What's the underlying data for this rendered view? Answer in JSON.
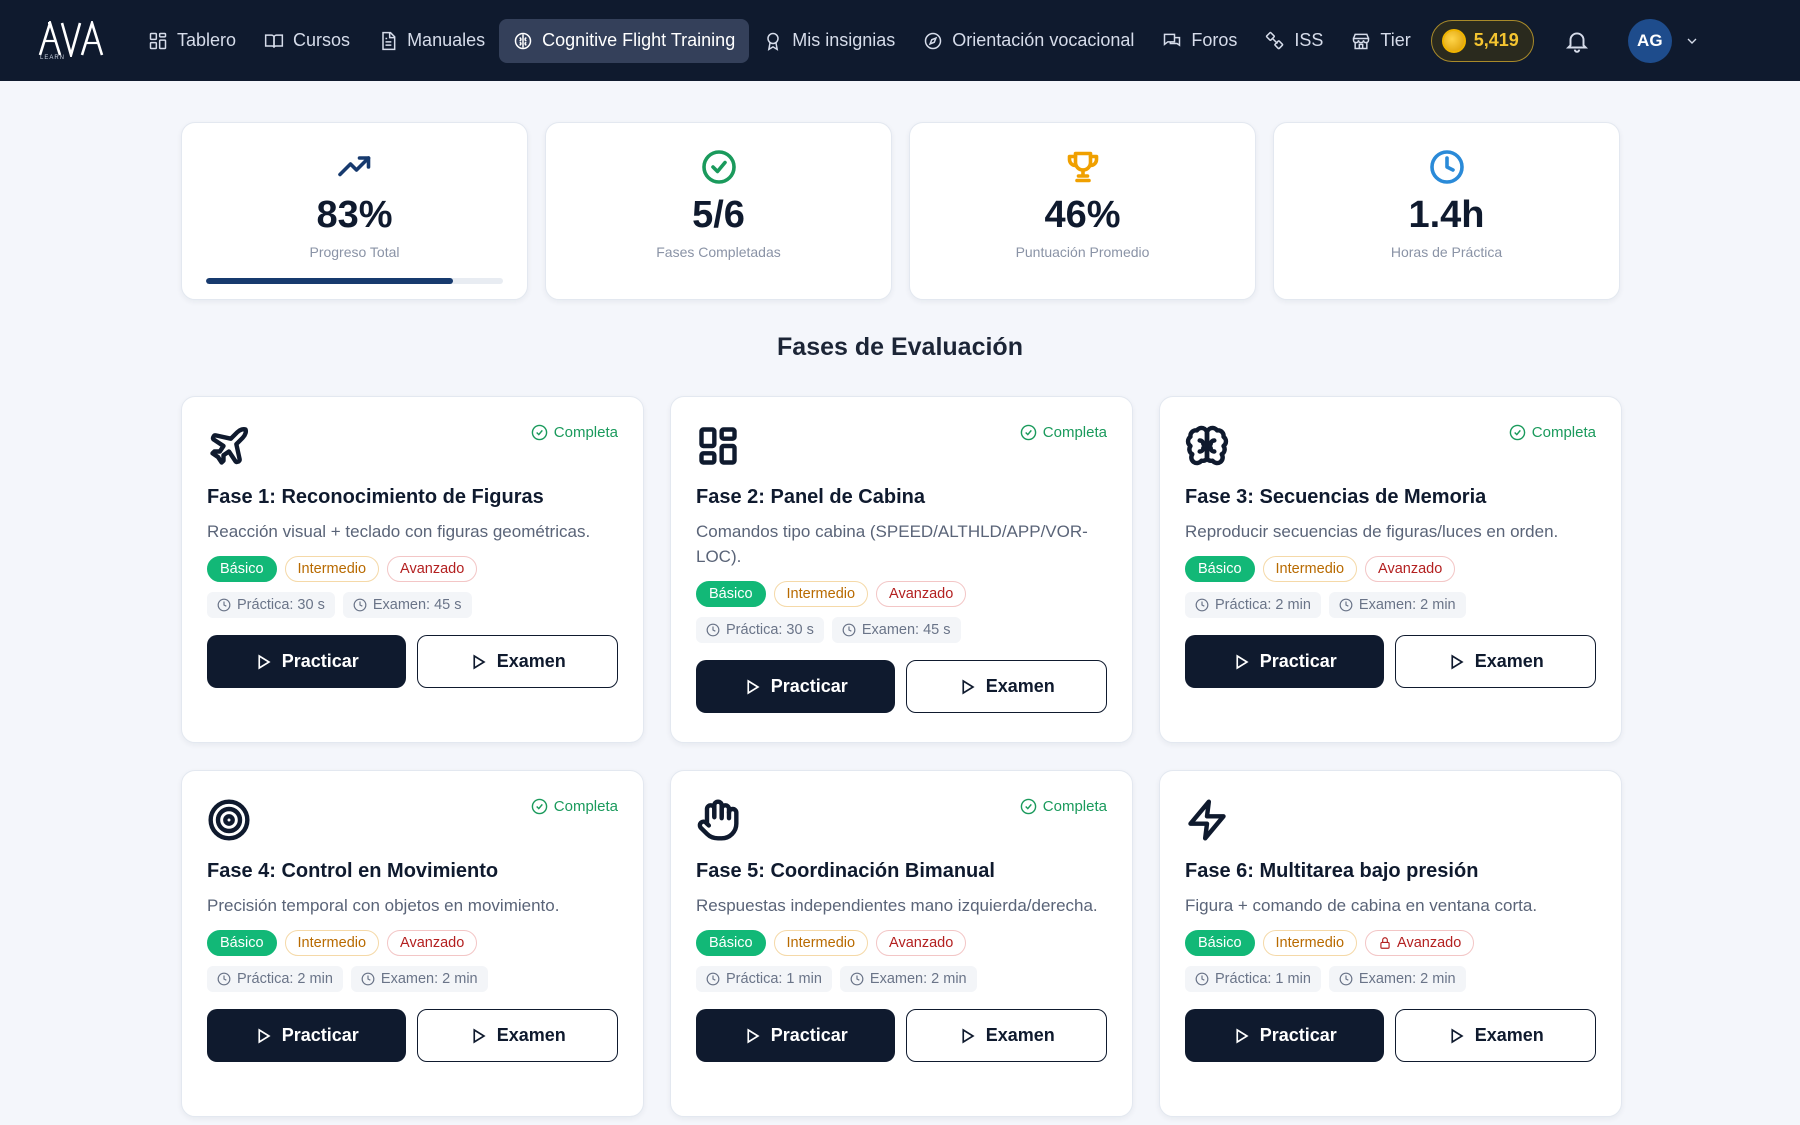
{
  "nav": {
    "logo_text": "AVIA",
    "logo_sub": "LEARN",
    "items": [
      {
        "label": "Tablero",
        "icon": "dashboard-icon"
      },
      {
        "label": "Cursos",
        "icon": "book-icon"
      },
      {
        "label": "Manuales",
        "icon": "document-icon"
      },
      {
        "label": "Cognitive Flight Training",
        "icon": "brain-icon",
        "active": true
      },
      {
        "label": "Mis insignias",
        "icon": "badge-icon"
      },
      {
        "label": "Orientación vocacional",
        "icon": "compass-icon"
      },
      {
        "label": "Foros",
        "icon": "chat-icon"
      },
      {
        "label": "ISS",
        "icon": "satellite-icon"
      },
      {
        "label": "Tier",
        "icon": "store-icon"
      }
    ],
    "coins": "5,419",
    "avatar_initials": "AG"
  },
  "stats": [
    {
      "value": "83%",
      "label": "Progreso Total",
      "icon": "trending-up-icon",
      "color": "#173a6e",
      "progress": 0.83
    },
    {
      "value": "5/6",
      "label": "Fases Completadas",
      "icon": "check-circle-icon",
      "color": "#1a9a5c"
    },
    {
      "value": "46%",
      "label": "Puntuación Promedio",
      "icon": "trophy-icon",
      "color": "#f0a000"
    },
    {
      "value": "1.4h",
      "label": "Horas de Práctica",
      "icon": "clock-icon",
      "color": "#2a8ad8"
    }
  ],
  "section_title": "Fases de Evaluación",
  "phases": [
    {
      "title": "Fase 1: Reconocimiento de Figuras",
      "desc": "Reacción visual + teclado con figuras geométricas.",
      "status": "Completa",
      "icon": "airplane-icon",
      "levels": [
        "Básico",
        "Intermedio",
        "Avanzado"
      ],
      "practice": "Práctica: 30 s",
      "exam": "Examen: 45 s",
      "btn_practice": "Practicar",
      "btn_exam": "Examen"
    },
    {
      "title": "Fase 2: Panel de Cabina",
      "desc": "Comandos tipo cabina (SPEED/ALTHLD/APP/VOR-LOC).",
      "status": "Completa",
      "icon": "panel-grid-icon",
      "levels": [
        "Básico",
        "Intermedio",
        "Avanzado"
      ],
      "practice": "Práctica: 30 s",
      "exam": "Examen: 45 s",
      "btn_practice": "Practicar",
      "btn_exam": "Examen"
    },
    {
      "title": "Fase 3: Secuencias de Memoria",
      "desc": "Reproducir secuencias de figuras/luces en orden.",
      "status": "Completa",
      "icon": "brain-icon",
      "levels": [
        "Básico",
        "Intermedio",
        "Avanzado"
      ],
      "practice": "Práctica: 2 min",
      "exam": "Examen: 2 min",
      "btn_practice": "Practicar",
      "btn_exam": "Examen"
    },
    {
      "title": "Fase 4: Control en Movimiento",
      "desc": "Precisión temporal con objetos en movimiento.",
      "status": "Completa",
      "icon": "target-icon",
      "levels": [
        "Básico",
        "Intermedio",
        "Avanzado"
      ],
      "practice": "Práctica: 2 min",
      "exam": "Examen: 2 min",
      "btn_practice": "Practicar",
      "btn_exam": "Examen"
    },
    {
      "title": "Fase 5: Coordinación Bimanual",
      "desc": "Respuestas independientes mano izquierda/derecha.",
      "status": "Completa",
      "icon": "hand-icon",
      "levels": [
        "Básico",
        "Intermedio",
        "Avanzado"
      ],
      "practice": "Práctica: 1 min",
      "exam": "Examen: 2 min",
      "btn_practice": "Practicar",
      "btn_exam": "Examen"
    },
    {
      "title": "Fase 6: Multitarea bajo presión",
      "desc": "Figura + comando de cabina en ventana corta.",
      "status": "",
      "icon": "lightning-icon",
      "levels": [
        "Básico",
        "Intermedio",
        "Avanzado"
      ],
      "advanced_locked": true,
      "practice": "Práctica: 1 min",
      "exam": "Examen: 2 min",
      "btn_practice": "Practicar",
      "btn_exam": "Examen"
    }
  ]
}
